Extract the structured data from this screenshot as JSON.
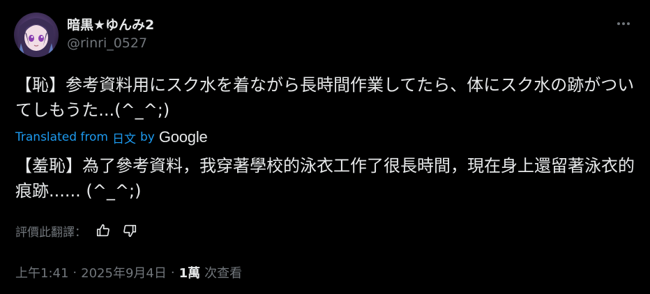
{
  "author": {
    "display_name": "暗黒★ゆんみ2",
    "handle": "@rinri_0527"
  },
  "tweet": {
    "text": "【恥】参考資料用にスク水を着ながら長時間作業してたら、体にスク水の跡がついてしもうた...(^_^;)"
  },
  "translation": {
    "prefix": "Translated from",
    "language": "日文",
    "by": "by",
    "provider": "Google",
    "text": "【羞恥】為了參考資料，我穿著學校的泳衣工作了很長時間，現在身上還留著泳衣的痕跡...... (^_^;)"
  },
  "rating": {
    "label": "評價此翻譯："
  },
  "meta": {
    "time": "上午1:41",
    "date": "2025年9月4日",
    "separator": "·",
    "views_count": "1萬",
    "views_label": "次查看"
  },
  "colors": {
    "background": "#000000",
    "text_primary": "#e7e9ea",
    "text_secondary": "#71767b",
    "link": "#1d9bf0"
  },
  "icons": {
    "more": "more-horizontal-icon",
    "good": "thumbs-up-icon",
    "bad": "thumbs-down-icon"
  }
}
